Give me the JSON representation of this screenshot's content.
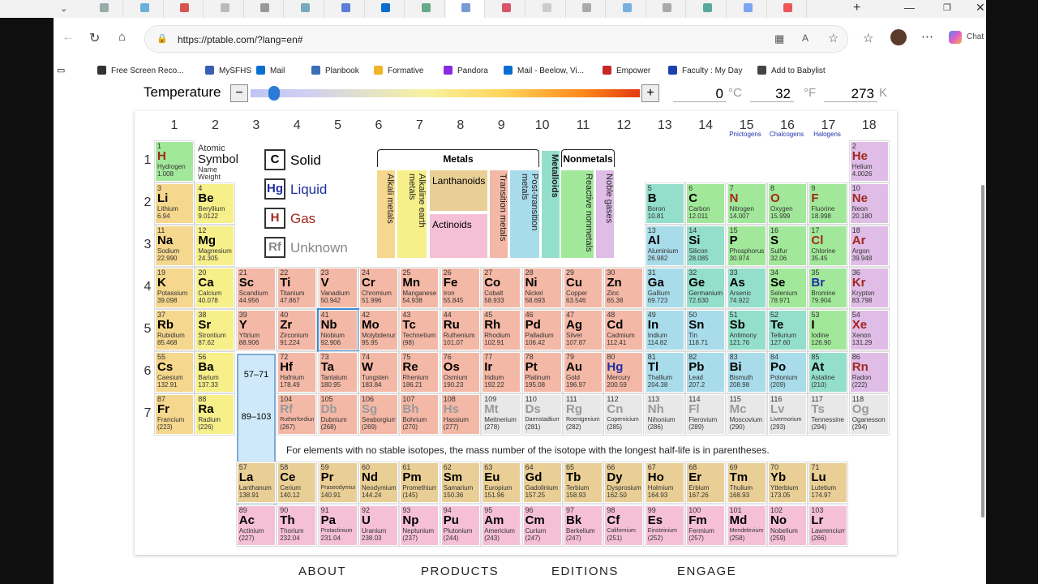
{
  "browser": {
    "url": "https://ptable.com/?lang=en#",
    "chat_label": "Chat",
    "tab_colors": [
      "#9aa",
      "#6ab0d8",
      "#d9534f",
      "#bbb",
      "#999",
      "#7ab",
      "#5b7fd6",
      "#0a6ed1",
      "#6a8",
      "#7a9ad6",
      "#d6566b",
      "#ccc",
      "#aaa",
      "#7ab0e0",
      "#aaa",
      "#5a9",
      "#7ba5f0",
      "#e55"
    ],
    "bookmarks": [
      {
        "label": "Free Screen Reco...",
        "color": "#333"
      },
      {
        "label": "MySFHS",
        "color": "#3b5db5"
      },
      {
        "label": "Mail",
        "color": "#0a6ed1"
      },
      {
        "label": "Planbook",
        "color": "#3b6eb5"
      },
      {
        "label": "Formative",
        "color": "#f0b429"
      },
      {
        "label": "Pandora",
        "color": "#8a2be2"
      },
      {
        "label": "Mail - Beelow, Vi...",
        "color": "#0a6ed1"
      },
      {
        "label": "Empower",
        "color": "#c62828"
      },
      {
        "label": "Faculty : My Day",
        "color": "#1e40af"
      },
      {
        "label": "Add to Babylist",
        "color": "#444"
      }
    ]
  },
  "temperature": {
    "label": "Temperature",
    "minus": "−",
    "plus": "+",
    "c_value": "0",
    "c_unit": "°C",
    "f_value": "32",
    "f_unit": "°F",
    "k_value": "273",
    "k_unit": "K"
  },
  "groups": [
    "1",
    "2",
    "3",
    "4",
    "5",
    "6",
    "7",
    "8",
    "9",
    "10",
    "11",
    "12",
    "13",
    "14",
    "15",
    "16",
    "17",
    "18"
  ],
  "families": {
    "g15": "Pnictogens",
    "g16": "Chalcogens",
    "g17": "Halogens"
  },
  "periods": [
    "1",
    "2",
    "3",
    "4",
    "5",
    "6",
    "7"
  ],
  "key": {
    "number": "Atomic",
    "symbol": "Symbol",
    "name": "Name",
    "weight": "Weight"
  },
  "states": [
    {
      "sym": "C",
      "label": "Solid",
      "color": "#000"
    },
    {
      "sym": "Hg",
      "label": "Liquid",
      "color": "#1f2fa0"
    },
    {
      "sym": "H",
      "label": "Gas",
      "color": "#a0281e"
    },
    {
      "sym": "Rf",
      "label": "Unknown",
      "color": "#888"
    }
  ],
  "categories": {
    "metals": "Metals",
    "nonmetals": "Nonmetals",
    "lanthanoids": "Lanthanoids",
    "actinoids": "Actinoids",
    "alkali": "Alkali metals",
    "alkaline": "Alkaline earth metals",
    "transition": "Transition metals",
    "post": "Post-transition metals",
    "metalloids": "Metalloids",
    "reactive": "Reactive nonmetals",
    "noble": "Noble gases"
  },
  "ranges": {
    "la": "57–71",
    "ac": "89–103"
  },
  "note": "For elements with no stable isotopes, the mass number of the isotope with the longest half-life is in parentheses.",
  "footer": [
    "ABOUT",
    "PRODUCTS",
    "EDITIONS",
    "ENGAGE"
  ],
  "elements": [
    [
      "1",
      "H",
      "Hydrogen",
      "1.008",
      1,
      1,
      "rn",
      "g"
    ],
    [
      "2",
      "He",
      "Helium",
      "4.0026",
      1,
      18,
      "ng",
      "g"
    ],
    [
      "3",
      "Li",
      "Lithium",
      "6.94",
      2,
      1,
      "alk",
      "s"
    ],
    [
      "4",
      "Be",
      "Beryllium",
      "9.0122",
      2,
      2,
      "ae",
      "s"
    ],
    [
      "5",
      "B",
      "Boron",
      "10.81",
      2,
      13,
      "md",
      "s"
    ],
    [
      "6",
      "C",
      "Carbon",
      "12.011",
      2,
      14,
      "rn",
      "s"
    ],
    [
      "7",
      "N",
      "Nitrogen",
      "14.007",
      2,
      15,
      "rn",
      "g"
    ],
    [
      "8",
      "O",
      "Oxygen",
      "15.999",
      2,
      16,
      "rn",
      "g"
    ],
    [
      "9",
      "F",
      "Fluorine",
      "18.998",
      2,
      17,
      "rn",
      "g"
    ],
    [
      "10",
      "Ne",
      "Neon",
      "20.180",
      2,
      18,
      "ng",
      "g"
    ],
    [
      "11",
      "Na",
      "Sodium",
      "22.990",
      3,
      1,
      "alk",
      "s"
    ],
    [
      "12",
      "Mg",
      "Magnesium",
      "24.305",
      3,
      2,
      "ae",
      "s"
    ],
    [
      "13",
      "Al",
      "Aluminium",
      "26.982",
      3,
      13,
      "pt",
      "s"
    ],
    [
      "14",
      "Si",
      "Silicon",
      "28.085",
      3,
      14,
      "md",
      "s"
    ],
    [
      "15",
      "P",
      "Phosphorus",
      "30.974",
      3,
      15,
      "rn",
      "s"
    ],
    [
      "16",
      "S",
      "Sulfur",
      "32.06",
      3,
      16,
      "rn",
      "s"
    ],
    [
      "17",
      "Cl",
      "Chlorine",
      "35.45",
      3,
      17,
      "rn",
      "g"
    ],
    [
      "18",
      "Ar",
      "Argon",
      "39.948",
      3,
      18,
      "ng",
      "g"
    ],
    [
      "19",
      "K",
      "Potassium",
      "39.098",
      4,
      1,
      "alk",
      "s"
    ],
    [
      "20",
      "Ca",
      "Calcium",
      "40.078",
      4,
      2,
      "ae",
      "s"
    ],
    [
      "21",
      "Sc",
      "Scandium",
      "44.956",
      4,
      3,
      "tm",
      "s"
    ],
    [
      "22",
      "Ti",
      "Titanium",
      "47.867",
      4,
      4,
      "tm",
      "s"
    ],
    [
      "23",
      "V",
      "Vanadium",
      "50.942",
      4,
      5,
      "tm",
      "s"
    ],
    [
      "24",
      "Cr",
      "Chromium",
      "51.996",
      4,
      6,
      "tm",
      "s"
    ],
    [
      "25",
      "Mn",
      "Manganese",
      "54.938",
      4,
      7,
      "tm",
      "s"
    ],
    [
      "26",
      "Fe",
      "Iron",
      "55.845",
      4,
      8,
      "tm",
      "s"
    ],
    [
      "27",
      "Co",
      "Cobalt",
      "58.933",
      4,
      9,
      "tm",
      "s"
    ],
    [
      "28",
      "Ni",
      "Nickel",
      "58.693",
      4,
      10,
      "tm",
      "s"
    ],
    [
      "29",
      "Cu",
      "Copper",
      "63.546",
      4,
      11,
      "tm",
      "s"
    ],
    [
      "30",
      "Zn",
      "Zinc",
      "65.38",
      4,
      12,
      "tm",
      "s"
    ],
    [
      "31",
      "Ga",
      "Gallium",
      "69.723",
      4,
      13,
      "pt",
      "s"
    ],
    [
      "32",
      "Ge",
      "Germanium",
      "72.630",
      4,
      14,
      "md",
      "s"
    ],
    [
      "33",
      "As",
      "Arsenic",
      "74.922",
      4,
      15,
      "md",
      "s"
    ],
    [
      "34",
      "Se",
      "Selenium",
      "78.971",
      4,
      16,
      "rn",
      "s"
    ],
    [
      "35",
      "Br",
      "Bromine",
      "79.904",
      4,
      17,
      "rn",
      "l"
    ],
    [
      "36",
      "Kr",
      "Krypton",
      "83.798",
      4,
      18,
      "ng",
      "g"
    ],
    [
      "37",
      "Rb",
      "Rubidium",
      "85.468",
      5,
      1,
      "alk",
      "s"
    ],
    [
      "38",
      "Sr",
      "Strontium",
      "87.62",
      5,
      2,
      "ae",
      "s"
    ],
    [
      "39",
      "Y",
      "Yttrium",
      "88.906",
      5,
      3,
      "tm",
      "s"
    ],
    [
      "40",
      "Zr",
      "Zirconium",
      "91.224",
      5,
      4,
      "tm",
      "s"
    ],
    [
      "41",
      "Nb",
      "Niobium",
      "92.906",
      5,
      5,
      "tm",
      "s"
    ],
    [
      "42",
      "Mo",
      "Molybdenum",
      "95.95",
      5,
      6,
      "tm",
      "s"
    ],
    [
      "43",
      "Tc",
      "Technetium",
      "(98)",
      5,
      7,
      "tm",
      "s"
    ],
    [
      "44",
      "Ru",
      "Ruthenium",
      "101.07",
      5,
      8,
      "tm",
      "s"
    ],
    [
      "45",
      "Rh",
      "Rhodium",
      "102.91",
      5,
      9,
      "tm",
      "s"
    ],
    [
      "46",
      "Pd",
      "Palladium",
      "106.42",
      5,
      10,
      "tm",
      "s"
    ],
    [
      "47",
      "Ag",
      "Silver",
      "107.87",
      5,
      11,
      "tm",
      "s"
    ],
    [
      "48",
      "Cd",
      "Cadmium",
      "112.41",
      5,
      12,
      "tm",
      "s"
    ],
    [
      "49",
      "In",
      "Indium",
      "114.82",
      5,
      13,
      "pt",
      "s"
    ],
    [
      "50",
      "Sn",
      "Tin",
      "118.71",
      5,
      14,
      "pt",
      "s"
    ],
    [
      "51",
      "Sb",
      "Antimony",
      "121.76",
      5,
      15,
      "md",
      "s"
    ],
    [
      "52",
      "Te",
      "Tellurium",
      "127.60",
      5,
      16,
      "md",
      "s"
    ],
    [
      "53",
      "I",
      "Iodine",
      "126.90",
      5,
      17,
      "rn",
      "s"
    ],
    [
      "54",
      "Xe",
      "Xenon",
      "131.29",
      5,
      18,
      "ng",
      "g"
    ],
    [
      "55",
      "Cs",
      "Caesium",
      "132.91",
      6,
      1,
      "alk",
      "s"
    ],
    [
      "56",
      "Ba",
      "Barium",
      "137.33",
      6,
      2,
      "ae",
      "s"
    ],
    [
      "72",
      "Hf",
      "Hafnium",
      "178.49",
      6,
      4,
      "tm",
      "s"
    ],
    [
      "73",
      "Ta",
      "Tantalum",
      "180.95",
      6,
      5,
      "tm",
      "s"
    ],
    [
      "74",
      "W",
      "Tungsten",
      "183.84",
      6,
      6,
      "tm",
      "s"
    ],
    [
      "75",
      "Re",
      "Rhenium",
      "186.21",
      6,
      7,
      "tm",
      "s"
    ],
    [
      "76",
      "Os",
      "Osmium",
      "190.23",
      6,
      8,
      "tm",
      "s"
    ],
    [
      "77",
      "Ir",
      "Iridium",
      "192.22",
      6,
      9,
      "tm",
      "s"
    ],
    [
      "78",
      "Pt",
      "Platinum",
      "195.08",
      6,
      10,
      "tm",
      "s"
    ],
    [
      "79",
      "Au",
      "Gold",
      "196.97",
      6,
      11,
      "tm",
      "s"
    ],
    [
      "80",
      "Hg",
      "Mercury",
      "200.59",
      6,
      12,
      "tm",
      "l"
    ],
    [
      "81",
      "Tl",
      "Thallium",
      "204.38",
      6,
      13,
      "pt",
      "s"
    ],
    [
      "82",
      "Pb",
      "Lead",
      "207.2",
      6,
      14,
      "pt",
      "s"
    ],
    [
      "83",
      "Bi",
      "Bismuth",
      "208.98",
      6,
      15,
      "pt",
      "s"
    ],
    [
      "84",
      "Po",
      "Polonium",
      "(209)",
      6,
      16,
      "pt",
      "s"
    ],
    [
      "85",
      "At",
      "Astatine",
      "(210)",
      6,
      17,
      "md",
      "s"
    ],
    [
      "86",
      "Rn",
      "Radon",
      "(222)",
      6,
      18,
      "ng",
      "g"
    ],
    [
      "87",
      "Fr",
      "Francium",
      "(223)",
      7,
      1,
      "alk",
      "s"
    ],
    [
      "88",
      "Ra",
      "Radium",
      "(226)",
      7,
      2,
      "ae",
      "s"
    ],
    [
      "104",
      "Rf",
      "Rutherfordium",
      "(267)",
      7,
      4,
      "tm",
      "u"
    ],
    [
      "105",
      "Db",
      "Dubnium",
      "(268)",
      7,
      5,
      "tm",
      "u"
    ],
    [
      "106",
      "Sg",
      "Seaborgium",
      "(269)",
      7,
      6,
      "tm",
      "u"
    ],
    [
      "107",
      "Bh",
      "Bohrium",
      "(270)",
      7,
      7,
      "tm",
      "u"
    ],
    [
      "108",
      "Hs",
      "Hassium",
      "(277)",
      7,
      8,
      "tm",
      "u"
    ],
    [
      "109",
      "Mt",
      "Meitnerium",
      "(278)",
      7,
      9,
      "un",
      "u"
    ],
    [
      "110",
      "Ds",
      "Darmstadtium",
      "(281)",
      7,
      10,
      "un",
      "u"
    ],
    [
      "111",
      "Rg",
      "Roentgenium",
      "(282)",
      7,
      11,
      "un",
      "u"
    ],
    [
      "112",
      "Cn",
      "Copernicium",
      "(285)",
      7,
      12,
      "un",
      "u"
    ],
    [
      "113",
      "Nh",
      "Nihonium",
      "(286)",
      7,
      13,
      "un",
      "u"
    ],
    [
      "114",
      "Fl",
      "Flerovium",
      "(289)",
      7,
      14,
      "un",
      "u"
    ],
    [
      "115",
      "Mc",
      "Moscovium",
      "(290)",
      7,
      15,
      "un",
      "u"
    ],
    [
      "116",
      "Lv",
      "Livermorium",
      "(293)",
      7,
      16,
      "un",
      "u"
    ],
    [
      "117",
      "Ts",
      "Tennessine",
      "(294)",
      7,
      17,
      "un",
      "u"
    ],
    [
      "118",
      "Og",
      "Oganesson",
      "(294)",
      7,
      18,
      "un",
      "u"
    ],
    [
      "57",
      "La",
      "Lanthanum",
      "138.91",
      8,
      3,
      "la",
      "s"
    ],
    [
      "58",
      "Ce",
      "Cerium",
      "140.12",
      8,
      4,
      "la",
      "s"
    ],
    [
      "59",
      "Pr",
      "Praseodymium",
      "140.91",
      8,
      5,
      "la",
      "s"
    ],
    [
      "60",
      "Nd",
      "Neodymium",
      "144.24",
      8,
      6,
      "la",
      "s"
    ],
    [
      "61",
      "Pm",
      "Promethium",
      "(145)",
      8,
      7,
      "la",
      "s"
    ],
    [
      "62",
      "Sm",
      "Samarium",
      "150.36",
      8,
      8,
      "la",
      "s"
    ],
    [
      "63",
      "Eu",
      "Europium",
      "151.96",
      8,
      9,
      "la",
      "s"
    ],
    [
      "64",
      "Gd",
      "Gadolinium",
      "157.25",
      8,
      10,
      "la",
      "s"
    ],
    [
      "65",
      "Tb",
      "Terbium",
      "158.93",
      8,
      11,
      "la",
      "s"
    ],
    [
      "66",
      "Dy",
      "Dysprosium",
      "162.50",
      8,
      12,
      "la",
      "s"
    ],
    [
      "67",
      "Ho",
      "Holmium",
      "164.93",
      8,
      13,
      "la",
      "s"
    ],
    [
      "68",
      "Er",
      "Erbium",
      "167.26",
      8,
      14,
      "la",
      "s"
    ],
    [
      "69",
      "Tm",
      "Thulium",
      "168.93",
      8,
      15,
      "la",
      "s"
    ],
    [
      "70",
      "Yb",
      "Ytterbium",
      "173.05",
      8,
      16,
      "la",
      "s"
    ],
    [
      "71",
      "Lu",
      "Lutetium",
      "174.97",
      8,
      17,
      "la",
      "s"
    ],
    [
      "89",
      "Ac",
      "Actinium",
      "(227)",
      9,
      3,
      "ac",
      "s"
    ],
    [
      "90",
      "Th",
      "Thorium",
      "232.04",
      9,
      4,
      "ac",
      "s"
    ],
    [
      "91",
      "Pa",
      "Protactinium",
      "231.04",
      9,
      5,
      "ac",
      "s"
    ],
    [
      "92",
      "U",
      "Uranium",
      "238.03",
      9,
      6,
      "ac",
      "s"
    ],
    [
      "93",
      "Np",
      "Neptunium",
      "(237)",
      9,
      7,
      "ac",
      "s"
    ],
    [
      "94",
      "Pu",
      "Plutonium",
      "(244)",
      9,
      8,
      "ac",
      "s"
    ],
    [
      "95",
      "Am",
      "Americium",
      "(243)",
      9,
      9,
      "ac",
      "s"
    ],
    [
      "96",
      "Cm",
      "Curium",
      "(247)",
      9,
      10,
      "ac",
      "s"
    ],
    [
      "97",
      "Bk",
      "Berkelium",
      "(247)",
      9,
      11,
      "ac",
      "s"
    ],
    [
      "98",
      "Cf",
      "Californium",
      "(251)",
      9,
      12,
      "ac",
      "s"
    ],
    [
      "99",
      "Es",
      "Einsteinium",
      "(252)",
      9,
      13,
      "ac",
      "s"
    ],
    [
      "100",
      "Fm",
      "Fermium",
      "(257)",
      9,
      14,
      "ac",
      "s"
    ],
    [
      "101",
      "Md",
      "Mendelevium",
      "(258)",
      9,
      15,
      "ac",
      "s"
    ],
    [
      "102",
      "No",
      "Nobelium",
      "(259)",
      9,
      16,
      "ac",
      "s"
    ],
    [
      "103",
      "Lr",
      "Lawrencium",
      "(266)",
      9,
      17,
      "ac",
      "s"
    ]
  ]
}
